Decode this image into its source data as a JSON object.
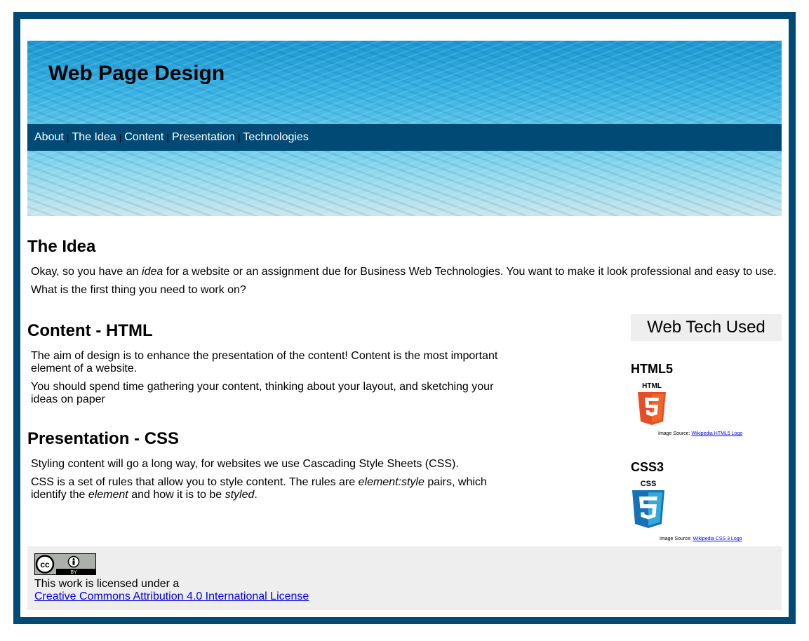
{
  "header": {
    "title": "Web Page Design"
  },
  "nav": {
    "items": [
      "About",
      "The Idea",
      "Content",
      "Presentation",
      "Technologies"
    ],
    "separator": "|"
  },
  "idea": {
    "heading": "The Idea",
    "p1_before": "Okay, so you have an ",
    "p1_em": "idea",
    "p1_after": " for a website or an assignment due for Business Web Technologies. You want to make it look professional and easy to use.",
    "p2": "What is the first thing you need to work on?"
  },
  "content": {
    "heading": "Content - HTML",
    "p1": "The aim of design is to enhance the presentation of the content! Content is the most important element of a website.",
    "p2": "You should spend time gathering your content, thinking about your layout, and sketching your ideas on paper"
  },
  "presentation": {
    "heading": "Presentation - CSS",
    "p1": "Styling content will go a long way, for websites we use Cascading Style Sheets (CSS).",
    "p2_a": "CSS is a set of rules that allow you to style content. The rules are ",
    "p2_em1": "element:style",
    "p2_b": " pairs, which identify the ",
    "p2_em2": "element",
    "p2_c": " and how it is to be ",
    "p2_em3": "styled",
    "p2_d": "."
  },
  "aside": {
    "title": "Web Tech Used",
    "html5": {
      "heading": "HTML5",
      "logo_text": "HTML",
      "source_label": "Image Source: ",
      "source_link": "Wikipedia HTML5 Logo"
    },
    "css3": {
      "heading": "CSS3",
      "logo_text": "CSS",
      "source_label": "Image Source: ",
      "source_link": "Wikipedia CSS 3 Logo"
    }
  },
  "footer": {
    "license_text": "This work is licensed under a",
    "license_link": "Creative Commons Attribution 4.0 International License"
  },
  "colors": {
    "frame": "#004a75",
    "nav": "#004a75",
    "panel": "#eeeeee",
    "link": "#0000ee",
    "html5": "#e44d26",
    "css3": "#1572b6"
  }
}
